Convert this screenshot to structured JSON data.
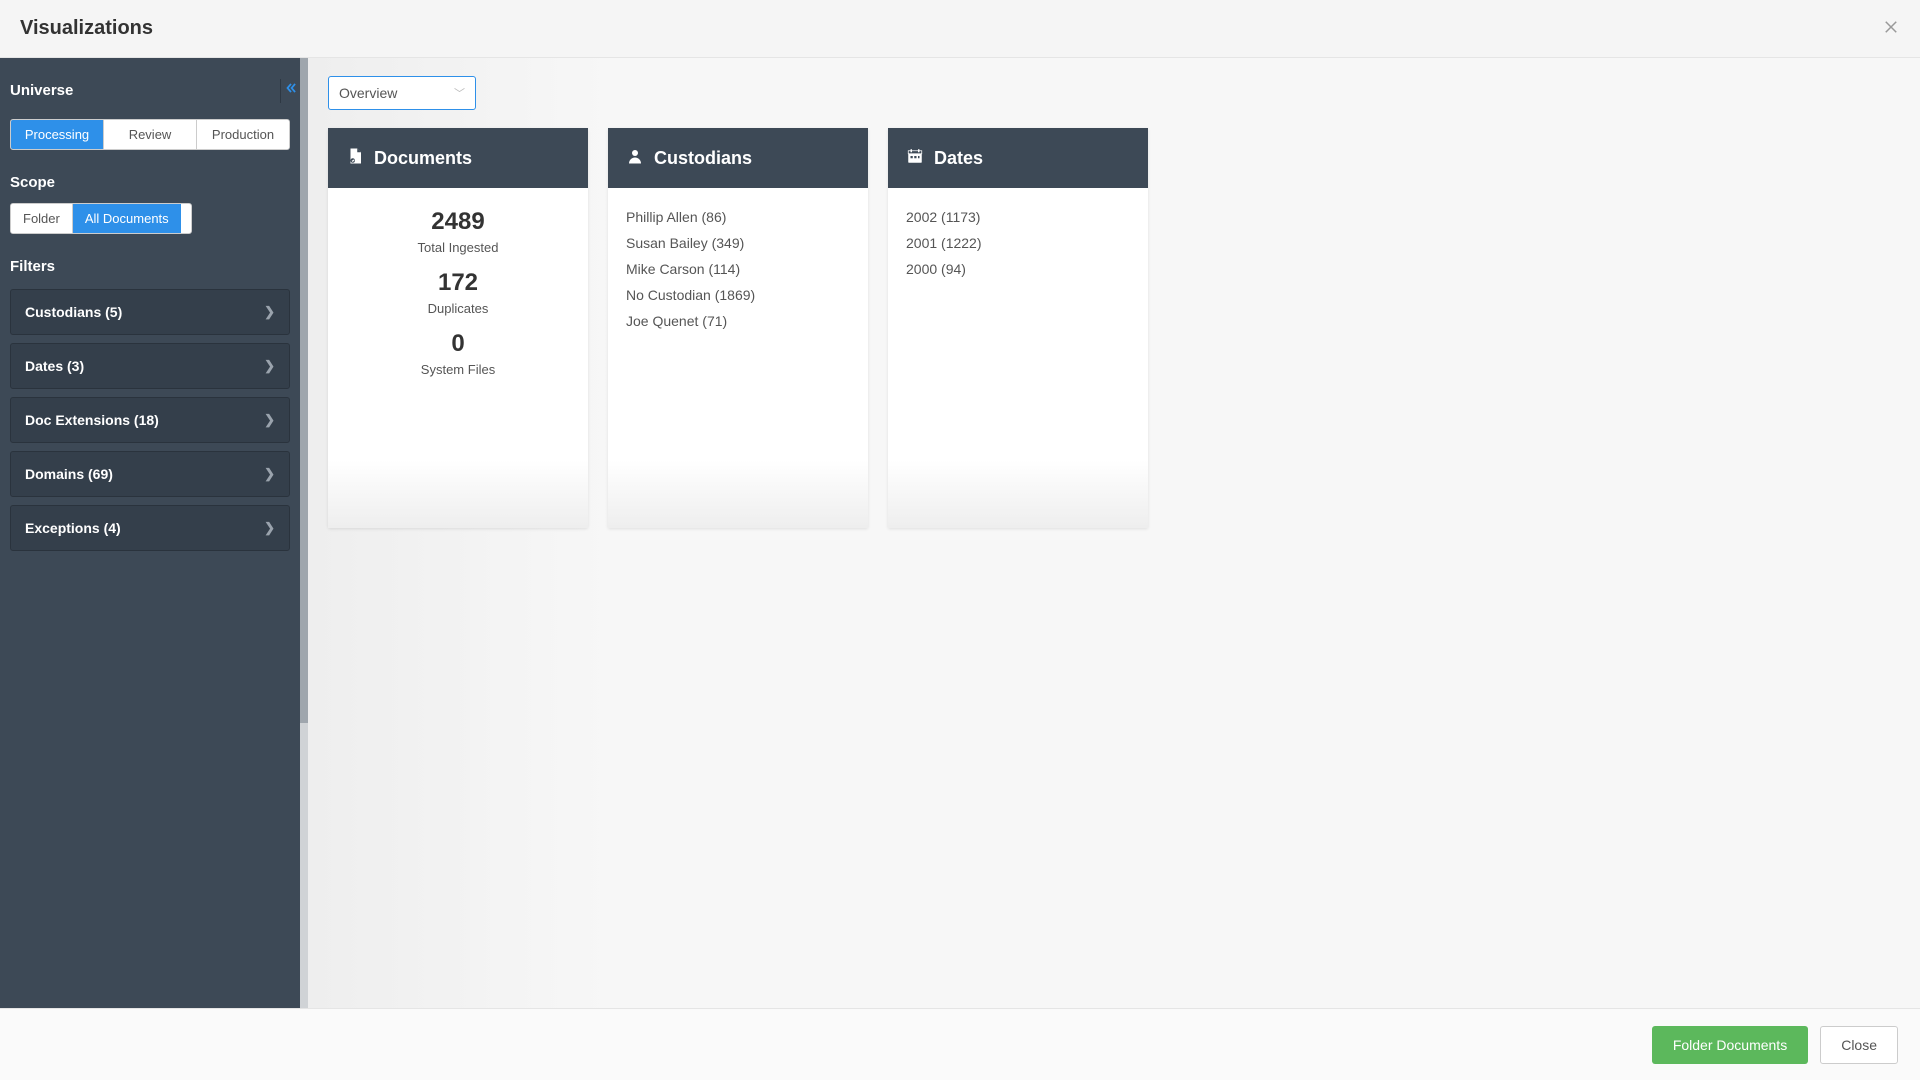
{
  "header": {
    "title": "Visualizations"
  },
  "sidebar": {
    "universe_label": "Universe",
    "tabs": [
      {
        "label": "Processing",
        "active": true
      },
      {
        "label": "Review",
        "active": false
      },
      {
        "label": "Production",
        "active": false
      }
    ],
    "scope_label": "Scope",
    "scope_options": [
      {
        "label": "Folder",
        "active": false
      },
      {
        "label": "All Documents",
        "active": true
      }
    ],
    "filters_label": "Filters",
    "filters": [
      {
        "label": "Custodians (5)"
      },
      {
        "label": "Dates (3)"
      },
      {
        "label": "Doc Extensions (18)"
      },
      {
        "label": "Domains (69)"
      },
      {
        "label": "Exceptions (4)"
      }
    ]
  },
  "main": {
    "view_select": "Overview",
    "cards": {
      "documents": {
        "title": "Documents",
        "stats": [
          {
            "value": "2489",
            "label": "Total Ingested"
          },
          {
            "value": "172",
            "label": "Duplicates"
          },
          {
            "value": "0",
            "label": "System Files"
          }
        ]
      },
      "custodians": {
        "title": "Custodians",
        "items": [
          "Phillip Allen (86)",
          "Susan Bailey (349)",
          "Mike Carson (114)",
          "No Custodian (1869)",
          "Joe Quenet (71)"
        ]
      },
      "dates": {
        "title": "Dates",
        "items": [
          "2002 (1173)",
          "2001 (1222)",
          "2000 (94)"
        ]
      }
    }
  },
  "footer": {
    "folder_btn": "Folder Documents",
    "close_btn": "Close"
  }
}
